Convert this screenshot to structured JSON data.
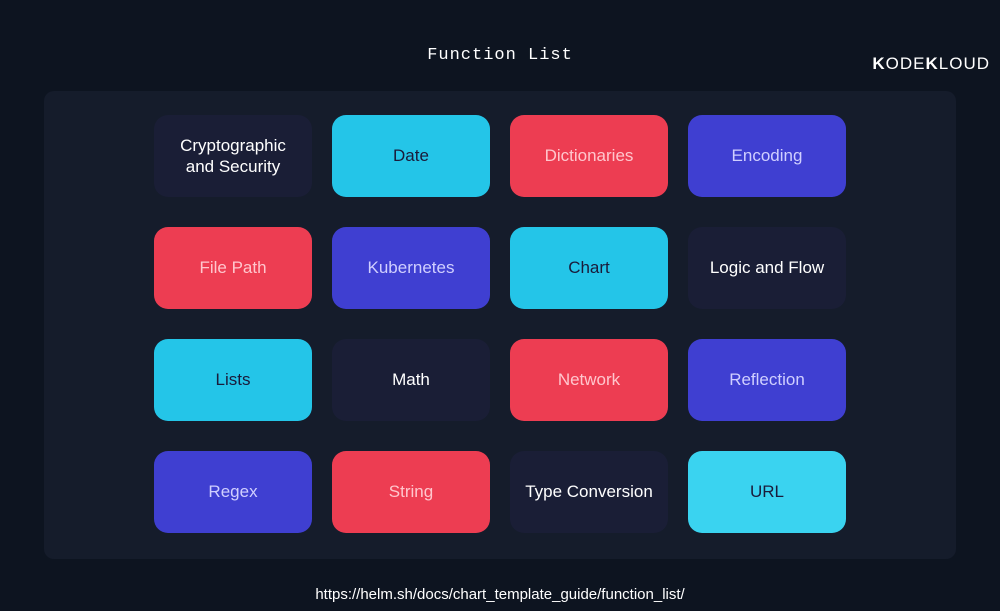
{
  "brand": "KODEKLOUD",
  "title": "Function List",
  "tiles": [
    {
      "label": "Cryptographic and Security",
      "color": "dark"
    },
    {
      "label": "Date",
      "color": "cyan"
    },
    {
      "label": "Dictionaries",
      "color": "red"
    },
    {
      "label": "Encoding",
      "color": "blue"
    },
    {
      "label": "File Path",
      "color": "red"
    },
    {
      "label": "Kubernetes",
      "color": "blue"
    },
    {
      "label": "Chart",
      "color": "cyan"
    },
    {
      "label": "Logic and Flow",
      "color": "dark"
    },
    {
      "label": "Lists",
      "color": "cyan"
    },
    {
      "label": "Math",
      "color": "dark"
    },
    {
      "label": "Network",
      "color": "red"
    },
    {
      "label": "Reflection",
      "color": "blue"
    },
    {
      "label": "Regex",
      "color": "blue"
    },
    {
      "label": "String",
      "color": "red"
    },
    {
      "label": "Type Conversion",
      "color": "dark"
    },
    {
      "label": "URL",
      "color": "cyan-light"
    }
  ],
  "footer_url": "https://helm.sh/docs/chart_template_guide/function_list/"
}
